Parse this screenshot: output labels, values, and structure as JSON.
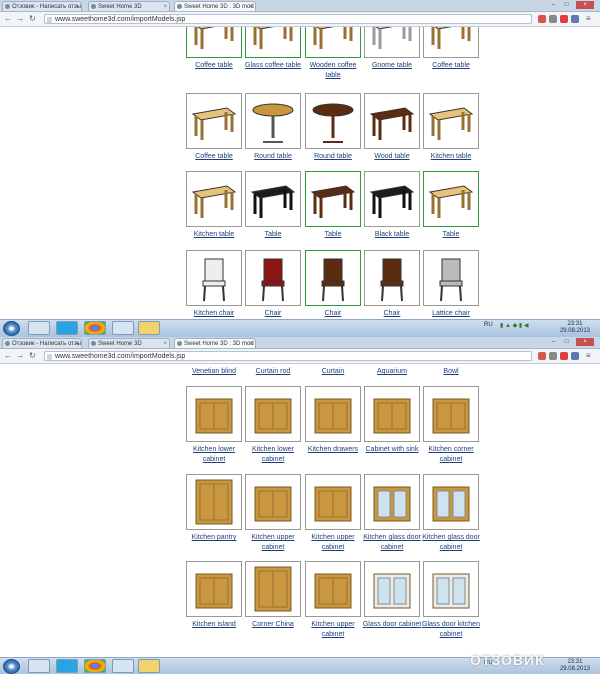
{
  "screens": [
    {
      "tabs": [
        {
          "label": "Отзовик - Написать отзы",
          "active": false
        },
        {
          "label": "Sweet Home 3D",
          "active": false
        },
        {
          "label": "Sweet Home 3D : 3D mod",
          "active": true
        }
      ],
      "url": "www.sweethome3d.com/importModels.jsp",
      "rows": [
        [
          {
            "label": "Coffee table",
            "selected": true,
            "icon": "coffee-table-icon"
          },
          {
            "label": "Glass coffee table",
            "selected": true,
            "icon": "glass-coffee-table-icon"
          },
          {
            "label": "Wooden coffee table",
            "selected": true,
            "icon": "wooden-coffee-table-icon"
          },
          {
            "label": "Gnome table",
            "selected": false,
            "icon": "gnome-table-icon"
          },
          {
            "label": "Coffee table",
            "selected": false,
            "icon": "coffee-table-icon"
          }
        ],
        [
          {
            "label": "Coffee table",
            "selected": false,
            "icon": "black-coffee-table-icon"
          },
          {
            "label": "Round table",
            "selected": false,
            "icon": "round-table-icon"
          },
          {
            "label": "Round table",
            "selected": false,
            "icon": "wooden-round-table-icon"
          },
          {
            "label": "Wood table",
            "selected": false,
            "icon": "wood-table-icon"
          },
          {
            "label": "Kitchen table",
            "selected": false,
            "icon": "kitchen-table-icon"
          }
        ],
        [
          {
            "label": "Kitchen table",
            "selected": false,
            "icon": "bar-kitchen-table-icon"
          },
          {
            "label": "Table",
            "selected": false,
            "icon": "black-table-icon"
          },
          {
            "label": "Table",
            "selected": true,
            "icon": "brown-table-icon"
          },
          {
            "label": "Black table",
            "selected": false,
            "icon": "black-desk-icon"
          },
          {
            "label": "Table",
            "selected": true,
            "icon": "light-table-icon"
          }
        ],
        [
          {
            "label": "Kitchen chair",
            "selected": false,
            "icon": "stool-chair-icon"
          },
          {
            "label": "Chair",
            "selected": false,
            "icon": "red-chair-icon"
          },
          {
            "label": "Chair",
            "selected": true,
            "icon": "wooden-chair-icon"
          },
          {
            "label": "Chair",
            "selected": false,
            "icon": "armchair-icon"
          },
          {
            "label": "Lattice chair",
            "selected": false,
            "icon": "lattice-chair-icon"
          }
        ]
      ],
      "taskbar": {
        "lang": "RU",
        "time": "23:31",
        "date": "29.08.2013"
      }
    },
    {
      "tabs": [
        {
          "label": "Отзовик - Написать отзы",
          "active": false
        },
        {
          "label": "Sweet Home 3D",
          "active": false
        },
        {
          "label": "Sweet Home 3D : 3D mod",
          "active": true
        }
      ],
      "url": "www.sweethome3d.com/importModels.jsp",
      "top_labels": [
        "Venetian blind",
        "Curtain rod",
        "Curtain",
        "Aquarium",
        "Bowl"
      ],
      "rows": [
        [
          {
            "label": "Kitchen lower cabinet",
            "selected": false,
            "icon": "lower-cabinet-icon"
          },
          {
            "label": "Kitchen lower cabinet",
            "selected": false,
            "icon": "lower-cabinet-double-icon"
          },
          {
            "label": "Kitchen drawers",
            "selected": false,
            "icon": "drawers-icon"
          },
          {
            "label": "Cabinet with sink",
            "selected": false,
            "icon": "sink-cabinet-icon"
          },
          {
            "label": "Kitchen corner cabinet",
            "selected": false,
            "icon": "corner-cabinet-icon"
          }
        ],
        [
          {
            "label": "Kitchen pantry",
            "selected": false,
            "icon": "pantry-icon"
          },
          {
            "label": "Kitchen upper cabinet",
            "selected": false,
            "icon": "upper-cabinet-icon"
          },
          {
            "label": "Kitchen upper cabinet",
            "selected": false,
            "icon": "upper-cabinet-wide-icon"
          },
          {
            "label": "Kitchen glass door cabinet",
            "selected": false,
            "icon": "glass-door-cabinet-icon"
          },
          {
            "label": "Kitchen glass door cabinet",
            "selected": false,
            "icon": "glass-door-cabinet-wide-icon"
          }
        ],
        [
          {
            "label": "Kitchen island",
            "selected": false,
            "icon": "kitchen-island-icon"
          },
          {
            "label": "Corner China",
            "selected": false,
            "icon": "corner-china-icon"
          },
          {
            "label": "Kitchen upper cabinet",
            "selected": false,
            "icon": "hood-cabinet-icon"
          },
          {
            "label": "Glass door cabinet",
            "selected": false,
            "icon": "white-glass-cabinet-icon"
          },
          {
            "label": "Glass door kitchen cabinet",
            "selected": false,
            "icon": "white-glass-kitchen-cabinet-icon"
          }
        ]
      ],
      "taskbar": {
        "lang": "RU",
        "time": "23:31",
        "date": "29.08.2013"
      }
    }
  ],
  "watermark": "ОТЗОВИК",
  "colors": {
    "link": "#1f3f7a",
    "selected_border": "#2e9a3e",
    "wood": "#c8973f",
    "dark_wood": "#5b2c12"
  }
}
